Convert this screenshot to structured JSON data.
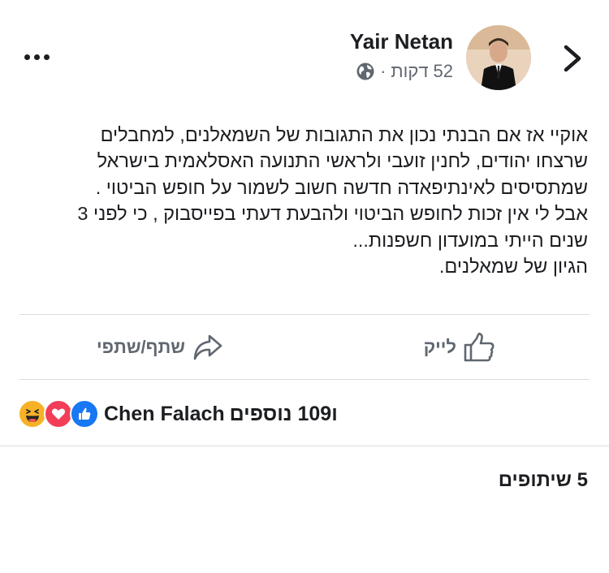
{
  "header": {
    "author_name": "Yair Netan",
    "time_value": "52",
    "time_unit": "דקות",
    "separator": "·",
    "privacy_icon": "globe-icon",
    "back_icon": "chevron-right-icon",
    "more_icon": "more-dots-icon"
  },
  "post": {
    "lines": [
      "אוקיי אז אם הבנתי נכון את התגובות של השמאלנים, למחבלים",
      "שרצחו יהודים, לחנין זועבי ולראשי התנועה האסלאמית בישראל",
      "שמתסיסים לאינתיפאדה חדשה חשוב לשמור על חופש הביטוי .",
      "אבל לי אין זכות לחופש הביטוי ולהבעת דעתי בפייסבוק , כי לפני 3",
      "שנים הייתי במועדון חשפנות...",
      "הגיון של שמאלנים."
    ]
  },
  "actions": {
    "like_label": "לייק",
    "share_label": "שתף/שתפי",
    "like_icon": "thumbs-up-icon",
    "share_icon": "share-arrow-icon"
  },
  "reactions": {
    "icons": [
      "like-icon",
      "love-icon",
      "haha-icon"
    ],
    "name": "Chen Falach",
    "others": "ו109 נוספים"
  },
  "shares": {
    "label": "5 שיתופים"
  },
  "colors": {
    "like_blue": "#1877f2",
    "love_red": "#f33e58",
    "haha_yellow": "#f7b125",
    "muted_text": "#606770",
    "divider": "#dadde1"
  }
}
